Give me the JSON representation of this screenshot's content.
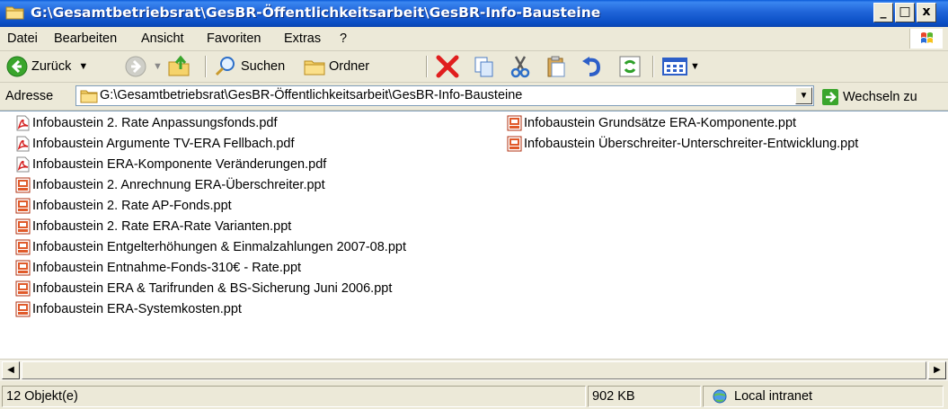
{
  "window": {
    "title": "G:\\Gesamtbetriebsrat\\GesBR-Öffentlichkeitsarbeit\\GesBR-Info-Bausteine",
    "controls": {
      "minimize": "_",
      "maximize": "□",
      "close": "x"
    }
  },
  "menu": {
    "items": [
      "Datei",
      "Bearbeiten",
      "Ansicht",
      "Favoriten",
      "Extras",
      "?"
    ]
  },
  "toolbar": {
    "back_label": "Zurück",
    "search_label": "Suchen",
    "folders_label": "Ordner"
  },
  "address": {
    "label": "Adresse",
    "value": "G:\\Gesamtbetriebsrat\\GesBR-Öffentlichkeitsarbeit\\GesBR-Info-Bausteine",
    "go_label": "Wechseln zu"
  },
  "files": [
    {
      "name": "Infobaustein 2. Rate Anpassungsfonds.pdf",
      "type": "pdf"
    },
    {
      "name": "Infobaustein Argumente TV-ERA Fellbach.pdf",
      "type": "pdf"
    },
    {
      "name": "Infobaustein ERA-Komponente Veränderungen.pdf",
      "type": "pdf"
    },
    {
      "name": "Infobaustein 2. Anrechnung ERA-Überschreiter.ppt",
      "type": "ppt"
    },
    {
      "name": "Infobaustein 2. Rate AP-Fonds.ppt",
      "type": "ppt"
    },
    {
      "name": "Infobaustein 2. Rate ERA-Rate Varianten.ppt",
      "type": "ppt"
    },
    {
      "name": "Infobaustein Entgelterhöhungen & Einmalzahlungen 2007-08.ppt",
      "type": "ppt"
    },
    {
      "name": "Infobaustein Entnahme-Fonds-310€ - Rate.ppt",
      "type": "ppt"
    },
    {
      "name": "Infobaustein ERA & Tarifrunden & BS-Sicherung Juni 2006.ppt",
      "type": "ppt"
    },
    {
      "name": "Infobaustein ERA-Systemkosten.ppt",
      "type": "ppt"
    },
    {
      "name": "Infobaustein Grundsätze ERA-Komponente.ppt",
      "type": "ppt"
    },
    {
      "name": "Infobaustein Überschreiter-Unterschreiter-Entwicklung.ppt",
      "type": "ppt"
    }
  ],
  "status": {
    "count": "12 Objekt(e)",
    "size": "902 KB",
    "zone": "Local intranet"
  }
}
